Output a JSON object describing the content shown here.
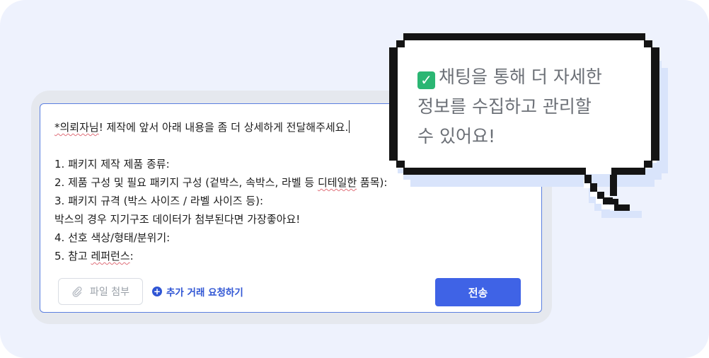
{
  "message": {
    "greeting_name": "*의뢰자님",
    "greeting_rest": "! 제작에 앞서 아래 내용을 좀 더 상세하게 전달해주세요.",
    "item1": "1. 패키지 제작 제품 종류:",
    "item2_a": "2. 제품 구성 및 필요 패키지 구성 (겉박스, 속박스, 라벨 등 ",
    "item2_b": "디테일한",
    "item2_c": " 품목):",
    "item3": "3. 패키지 규격 (박스 사이즈 / 라벨 사이즈 등):",
    "item3_note": "박스의 경우 지기구조 데이터가 첨부된다면 가장좋아요!",
    "item4": "4. 선호 색상/형태/분위기:",
    "item5_a": "5. 참고 ",
    "item5_b": "레퍼런스",
    "item5_c": ":"
  },
  "actions": {
    "attach_label": "파일 첨부",
    "attach_icon": "paperclip-icon",
    "add_deal_label": "추가 거래 요청하기",
    "add_deal_icon": "plus-circle-icon",
    "send_label": "전송"
  },
  "callout": {
    "icon": "check-mark-icon",
    "line1": "채팅을 통해 더 자세한",
    "line2": "정보를 수집하고 관리할",
    "line3": "수 있어요!"
  },
  "colors": {
    "accent": "#3f63e6",
    "link": "#2f55d4",
    "check": "#2bb673",
    "background": "#eef2fd"
  }
}
